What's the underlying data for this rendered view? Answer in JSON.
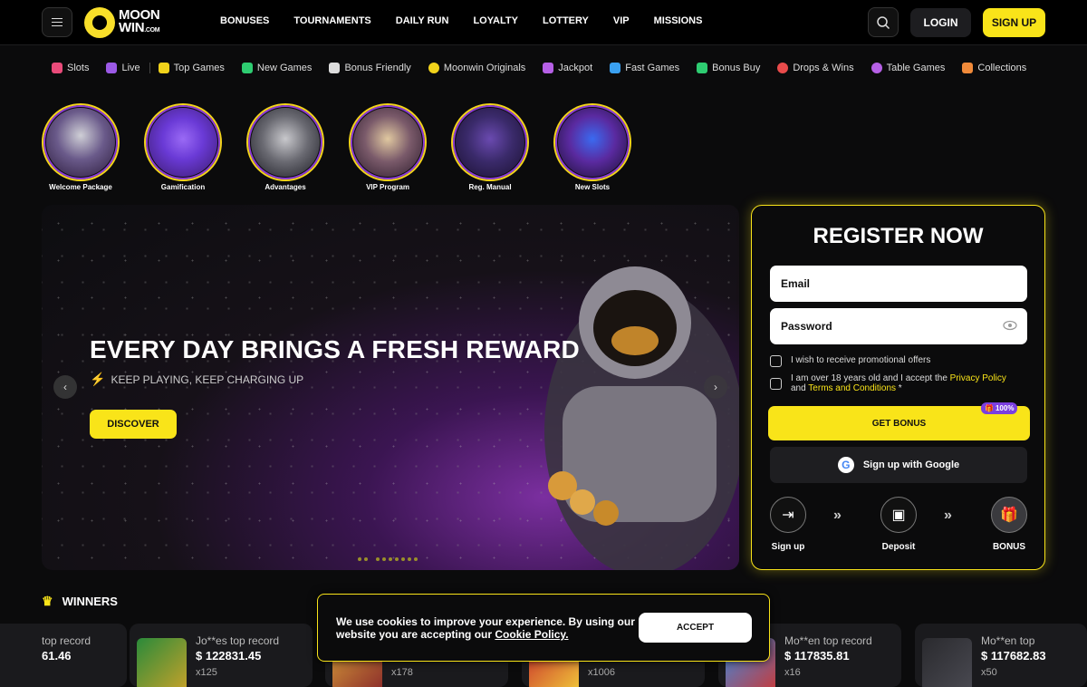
{
  "header": {
    "logo_text_1": "MOON",
    "logo_text_2": "WIN",
    "logo_text_3": ".COM",
    "nav": [
      "BONUSES",
      "TOURNAMENTS",
      "DAILY RUN",
      "LOYALTY",
      "LOTTERY",
      "VIP",
      "MISSIONS"
    ],
    "login_label": "LOGIN",
    "signup_label": "SIGN UP"
  },
  "categories": [
    {
      "label": "Slots",
      "color": "#e94b7a"
    },
    {
      "label": "Live",
      "color": "#9b59e6"
    },
    {
      "label": "Top Games",
      "color": "#f2d31b"
    },
    {
      "label": "New Games",
      "color": "#2ecc71"
    },
    {
      "label": "Bonus Friendly",
      "color": "#dddddd"
    },
    {
      "label": "Moonwin Originals",
      "color": "#f2d31b"
    },
    {
      "label": "Jackpot",
      "color": "#b660e6"
    },
    {
      "label": "Fast Games",
      "color": "#3aa0f0"
    },
    {
      "label": "Bonus Buy",
      "color": "#2ecc71"
    },
    {
      "label": "Drops & Wins",
      "color": "#e94b4b"
    },
    {
      "label": "Table Games",
      "color": "#b660e6"
    },
    {
      "label": "Collections",
      "color": "#f08a3a"
    }
  ],
  "stories": [
    {
      "label": "Welcome Package",
      "bg": "#5a4a7a"
    },
    {
      "label": "Gamification",
      "bg": "#7a4ae0"
    },
    {
      "label": "Advantages",
      "bg": "#4a4a5a"
    },
    {
      "label": "VIP Program",
      "bg": "#5a4a6a"
    },
    {
      "label": "Reg. Manual",
      "bg": "#3a2a6a"
    },
    {
      "label": "New Slots",
      "bg": "#4a3a7a"
    }
  ],
  "hero": {
    "title": "EVERY DAY BRINGS A FRESH REWARD",
    "subtitle": "KEEP PLAYING, KEEP CHARGING UP",
    "cta": "DISCOVER"
  },
  "register": {
    "title": "REGISTER NOW",
    "email_placeholder": "Email",
    "password_placeholder": "Password",
    "promo_label": "I wish to receive promotional offers",
    "age_label_1": "I am over 18 years old and I accept the ",
    "privacy_link": "Privacy Policy",
    "age_label_2": " and ",
    "terms_link": "Terms and Conditions",
    "age_label_3": " *",
    "bonus_button": "GET BONUS",
    "bonus_badge": "100%",
    "google_button": "Sign up with Google",
    "steps": [
      "Sign up",
      "Deposit",
      "BONUS"
    ]
  },
  "winners": {
    "title": "WINNERS",
    "cards": [
      {
        "name": "top record",
        "amount": "61.46",
        "mult": ""
      },
      {
        "name": "Jo**es top record",
        "amount": "$ 122831.45",
        "mult": "x125"
      },
      {
        "name": "",
        "amount": "",
        "mult": "x178"
      },
      {
        "name": "",
        "amount": "",
        "mult": "x1006"
      },
      {
        "name": "Mo**en top record",
        "amount": "$ 117835.81",
        "mult": "x16"
      },
      {
        "name": "Mo**en top",
        "amount": "$ 117682.83",
        "mult": "x50"
      }
    ]
  },
  "cookie": {
    "text": "We use cookies to improve your experience. By using our website you are accepting our ",
    "link": "Cookie Policy.",
    "accept": "ACCEPT"
  }
}
